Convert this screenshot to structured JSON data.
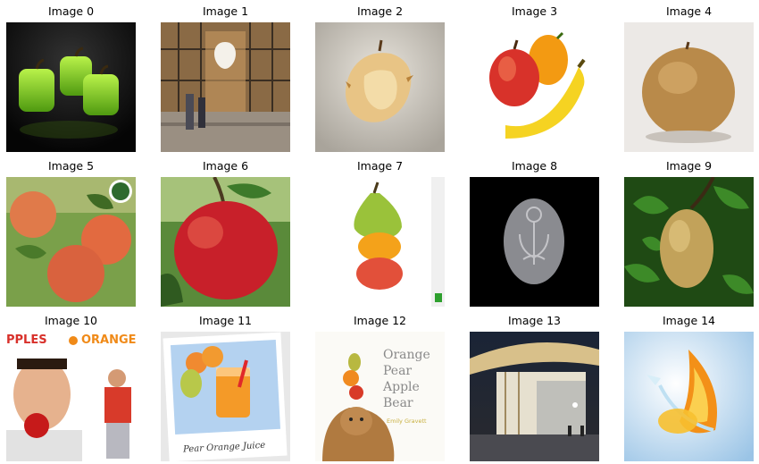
{
  "images": [
    {
      "title": "Image 0",
      "content": "three green cube-shaped apples on dark background",
      "art": "green-cubes"
    },
    {
      "title": "Image 1",
      "content": "glass storefront with white apple logo and pedestrians",
      "art": "store-front"
    },
    {
      "title": "Image 2",
      "content": "eaten apple core",
      "art": "apple-core"
    },
    {
      "title": "Image 3",
      "content": "red apple, orange and banana",
      "art": "fruit-trio"
    },
    {
      "title": "Image 4",
      "content": "brown asian pear",
      "art": "brown-pear"
    },
    {
      "title": "Image 5",
      "content": "red-orange apples on tree branch",
      "art": "tree-apples"
    },
    {
      "title": "Image 6",
      "content": "red apple hanging on branch",
      "art": "red-apple"
    },
    {
      "title": "Image 7",
      "content": "stack of pear, orange and apple",
      "art": "fruit-stack"
    },
    {
      "title": "Image 8",
      "content": "gray oval icon on black background",
      "art": "gray-icon"
    },
    {
      "title": "Image 9",
      "content": "pear hanging among green leaves",
      "art": "leaf-pear"
    },
    {
      "title": "Image 10",
      "content": "poster with man holding apple in mouth",
      "art": "poster",
      "banner_text": "PPLES",
      "banner_text2": "ORANGE"
    },
    {
      "title": "Image 11",
      "content": "glass of orange juice with fruit",
      "art": "juice",
      "caption_text": "Pear Orange Juice"
    },
    {
      "title": "Image 12",
      "content": "book cover with bear balancing fruits",
      "art": "book",
      "book_lines": [
        "Orange",
        "Pear",
        "Apple",
        "Bear"
      ],
      "book_author": "Emily Gravett"
    },
    {
      "title": "Image 13",
      "content": "modern curved roof store at night",
      "art": "night-store"
    },
    {
      "title": "Image 14",
      "content": "orange peel with splash",
      "art": "orange-peel"
    }
  ]
}
